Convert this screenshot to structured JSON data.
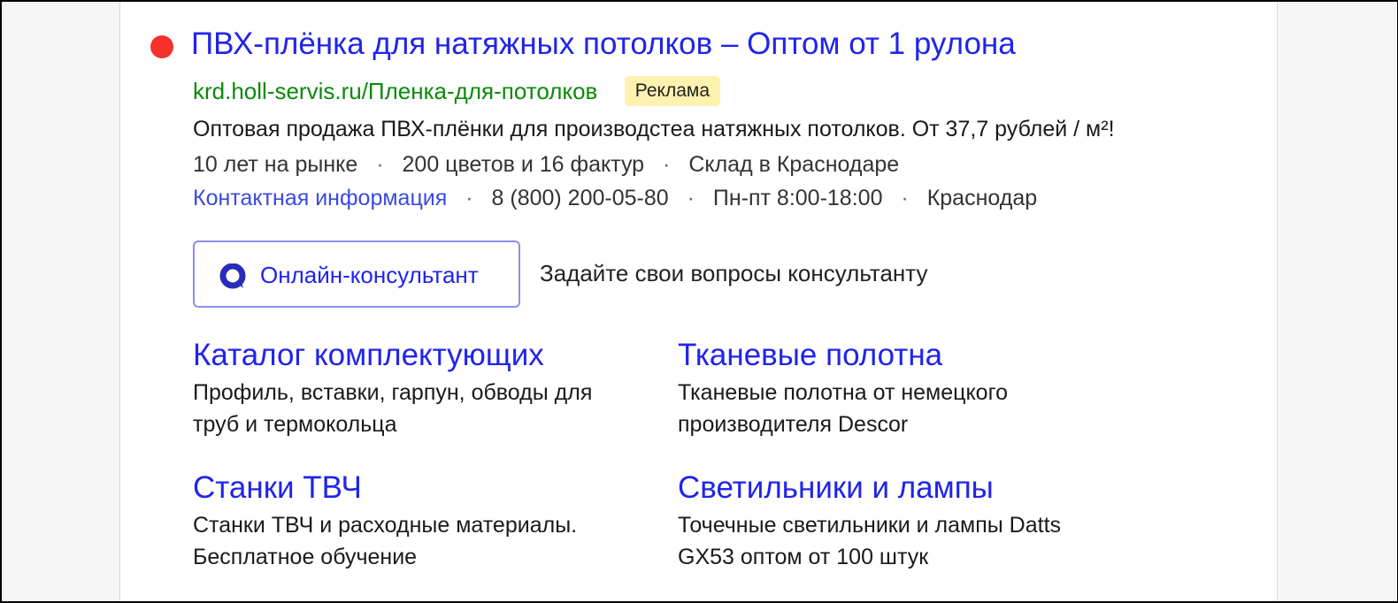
{
  "ad": {
    "title": "ПВХ-плёнка для натяжных потолков – Оптом от 1 рулона",
    "url": "krd.holl-servis.ru/Пленка-для-потолков",
    "badge": "Реклама",
    "description": "Оптовая продажа ПВХ-плёнки для производстеа натяжных потолков. От 37,7 рублей / м²!",
    "features": [
      "10 лет на рынке",
      "200 цветов и 16 фактур",
      "Склад в Краснодаре"
    ],
    "separator": "·",
    "contacts": {
      "link": "Контактная информация",
      "phone": "8 (800) 200-05-80",
      "hours": "Пн-пт 8:00-18:00",
      "city": "Краснодар"
    },
    "consultant": {
      "button_label": "Онлайн-консультант",
      "hint": "Задайте свои вопросы консультанту"
    },
    "sitelinks": [
      {
        "title": "Каталог комплектующих",
        "desc": "Профиль, вставки, гарпун, обводы для труб и термокольца"
      },
      {
        "title": "Тканевые полотна",
        "desc": "Тканевые полотна от немецкого производителя Descor"
      },
      {
        "title": "Станки ТВЧ",
        "desc": "Станки ТВЧ и расходные материалы. Бесплатное обучение"
      },
      {
        "title": "Светильники и лампы",
        "desc": "Точечные светильники и лампы Datts GX53 оптом от 100 штук"
      }
    ]
  },
  "colors": {
    "link": "#2024ea",
    "url": "#0a8a0a",
    "dot": "#f4322a",
    "badge_bg": "#fff2b0",
    "button_border": "#8d8ff0"
  },
  "icons": {
    "status": "red-dot-icon",
    "consultant": "chat-bubble-icon"
  }
}
